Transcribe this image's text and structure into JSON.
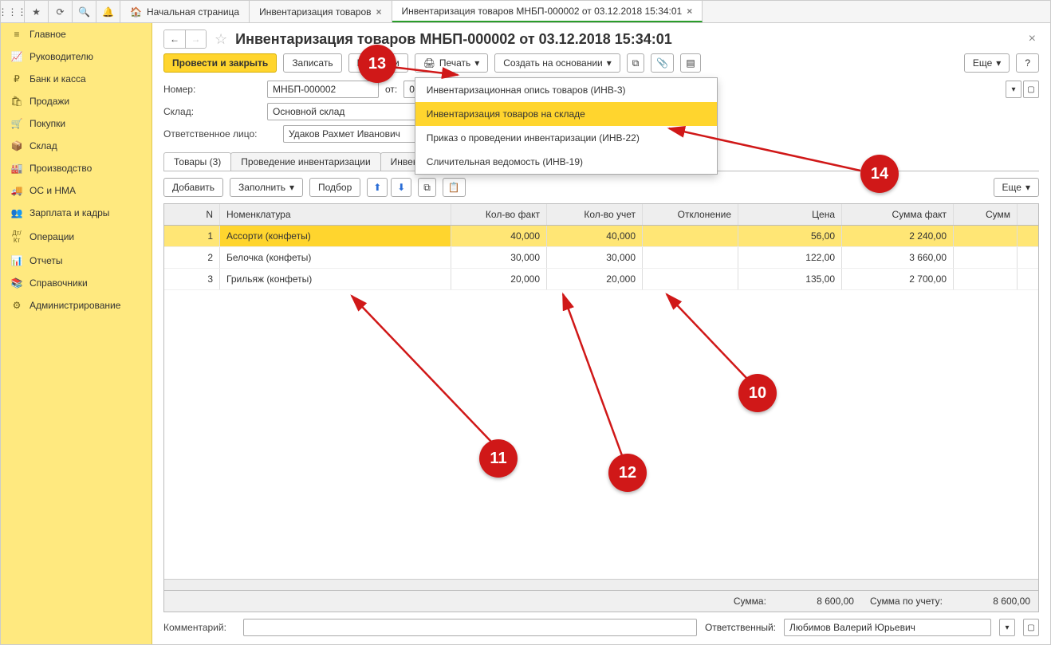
{
  "topIcons": [
    "⋮⋮⋮",
    "★",
    "⟳",
    "🔍",
    "🔔"
  ],
  "tabs": [
    {
      "icon": "🏠",
      "label": "Начальная страница",
      "closable": false,
      "active": false
    },
    {
      "icon": "",
      "label": "Инвентаризация товаров",
      "closable": true,
      "active": false
    },
    {
      "icon": "",
      "label": "Инвентаризация товаров МНБП-000002 от 03.12.2018 15:34:01",
      "closable": true,
      "active": true
    }
  ],
  "nav": [
    {
      "icon": "≡",
      "label": "Главное"
    },
    {
      "icon": "📈",
      "label": "Руководителю"
    },
    {
      "icon": "₽",
      "label": "Банк и касса"
    },
    {
      "icon": "🛍",
      "label": "Продажи"
    },
    {
      "icon": "🛒",
      "label": "Покупки"
    },
    {
      "icon": "📦",
      "label": "Склад"
    },
    {
      "icon": "🏭",
      "label": "Производство"
    },
    {
      "icon": "🚚",
      "label": "ОС и НМА"
    },
    {
      "icon": "👥",
      "label": "Зарплата и кадры"
    },
    {
      "icon": "Дт/Кт",
      "label": "Операции"
    },
    {
      "icon": "📊",
      "label": "Отчеты"
    },
    {
      "icon": "📚",
      "label": "Справочники"
    },
    {
      "icon": "⚙",
      "label": "Администрирование"
    }
  ],
  "doc": {
    "title": "Инвентаризация товаров МНБП-000002 от 03.12.2018 15:34:01",
    "buttons": {
      "post_close": "Провести и закрыть",
      "save": "Записать",
      "post": "Провести",
      "print": "Печать",
      "create_on": "Создать на основании",
      "more": "Еще",
      "help": "?"
    },
    "labels": {
      "number": "Номер:",
      "from": "от:",
      "warehouse": "Склад:",
      "responsible": "Ответственное лицо:",
      "comment": "Комментарий:",
      "resp_person": "Ответственный:"
    },
    "values": {
      "number": "МНБП-000002",
      "date": "03.12.2018 15:34:01",
      "warehouse": "Основной склад",
      "responsible": "Удаков Рахмет Иванович",
      "comment": "",
      "resp_user": "Любимов Валерий Юрьевич"
    }
  },
  "printMenu": [
    {
      "label": "Инвентаризационная опись товаров (ИНВ-3)",
      "hover": false
    },
    {
      "label": "Инвентаризация товаров на складе",
      "hover": true
    },
    {
      "label": "Приказ о проведении инвентаризации (ИНВ-22)",
      "hover": false
    },
    {
      "label": "Сличительная ведомость (ИНВ-19)",
      "hover": false
    }
  ],
  "subtabs": [
    {
      "label": "Товары (3)",
      "active": true
    },
    {
      "label": "Проведение инвентаризации",
      "active": false
    },
    {
      "label": "Инвентаризационная комиссия",
      "active": false
    }
  ],
  "gridToolbar": {
    "add": "Добавить",
    "fill": "Заполнить",
    "select": "Подбор",
    "more": "Еще"
  },
  "columns": {
    "n": "N",
    "nom": "Номенклатура",
    "qf": "Кол-во факт",
    "qu": "Кол-во учет",
    "dev": "Отклонение",
    "price": "Цена",
    "sf": "Сумма факт",
    "su": "Сумм"
  },
  "rows": [
    {
      "n": "1",
      "nom": "Ассорти (конфеты)",
      "qf": "40,000",
      "qu": "40,000",
      "dev": "",
      "price": "56,00",
      "sf": "2 240,00",
      "sel": true
    },
    {
      "n": "2",
      "nom": "Белочка (конфеты)",
      "qf": "30,000",
      "qu": "30,000",
      "dev": "",
      "price": "122,00",
      "sf": "3 660,00",
      "sel": false
    },
    {
      "n": "3",
      "nom": "Грильяж (конфеты)",
      "qf": "20,000",
      "qu": "20,000",
      "dev": "",
      "price": "135,00",
      "sf": "2 700,00",
      "sel": false
    }
  ],
  "totals": {
    "sum_label": "Сумма:",
    "sum": "8 600,00",
    "sum_acc_label": "Сумма по учету:",
    "sum_acc": "8 600,00"
  },
  "chart_data": {
    "type": "table",
    "columns": [
      "N",
      "Номенклатура",
      "Кол-во факт",
      "Кол-во учет",
      "Отклонение",
      "Цена",
      "Сумма факт"
    ],
    "rows": [
      [
        1,
        "Ассорти (конфеты)",
        40.0,
        40.0,
        null,
        56.0,
        2240.0
      ],
      [
        2,
        "Белочка (конфеты)",
        30.0,
        30.0,
        null,
        122.0,
        3660.0
      ],
      [
        3,
        "Грильяж (конфеты)",
        20.0,
        20.0,
        null,
        135.0,
        2700.0
      ]
    ],
    "totals": {
      "Сумма": 8600.0,
      "Сумма по учету": 8600.0
    }
  },
  "annotations": {
    "a10": "10",
    "a11": "11",
    "a12": "12",
    "a13": "13",
    "a14": "14"
  }
}
